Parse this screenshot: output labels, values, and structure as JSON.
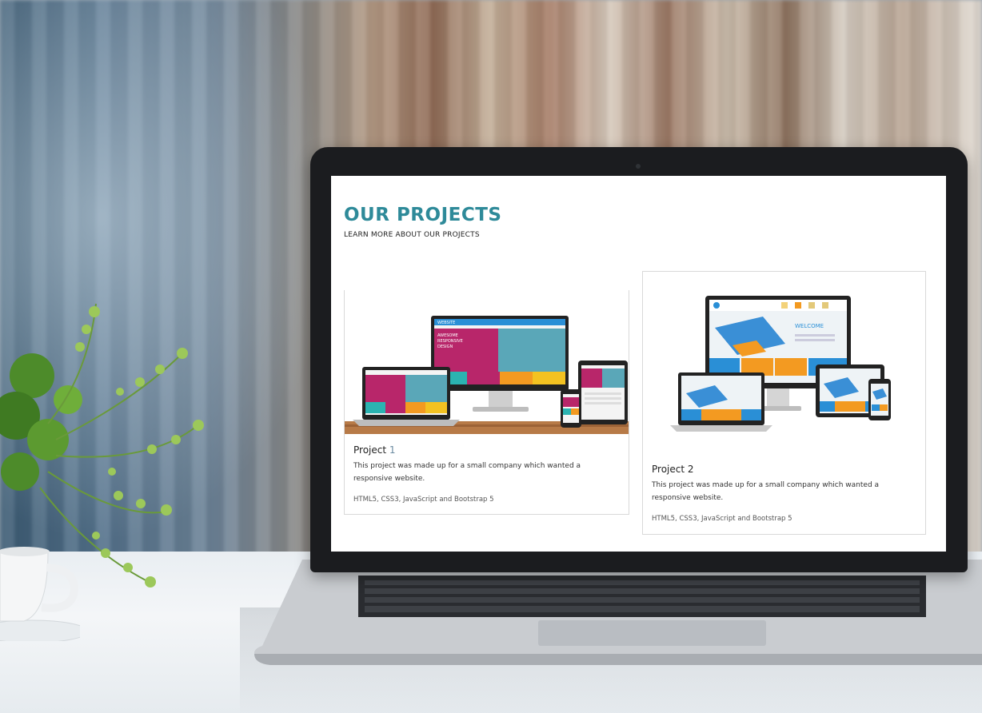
{
  "page": {
    "title": "OUR PROJECTS",
    "subtitle": "LEARN MORE ABOUT OUR PROJECTS"
  },
  "projects": [
    {
      "title_word": "Project",
      "title_num": "1",
      "description": "This project was made up for a small company which wanted a responsive website.",
      "tech": "HTML5, CSS3, JavaScript and Bootstrap 5",
      "image_icon": "responsive-devices-mockup-icon"
    },
    {
      "title_word": "Project",
      "title_num": "2",
      "description": "This project was made up for a small company which wanted a responsive website.",
      "tech": "HTML5, CSS3, JavaScript and Bootstrap 5",
      "image_icon": "responsive-devices-mockup-icon"
    }
  ],
  "mockup_text": {
    "website": "WEBSITE",
    "awesome": "AWESOME",
    "responsive": "RESPONSIVE",
    "design": "DESIGN",
    "welcome": "WELCOME"
  },
  "colors": {
    "accent": "#2e8a99",
    "magenta": "#b8266a",
    "teal_tile": "#2bb3b1",
    "orange_tile": "#f39a21",
    "blue_tile": "#2a8fd6"
  }
}
